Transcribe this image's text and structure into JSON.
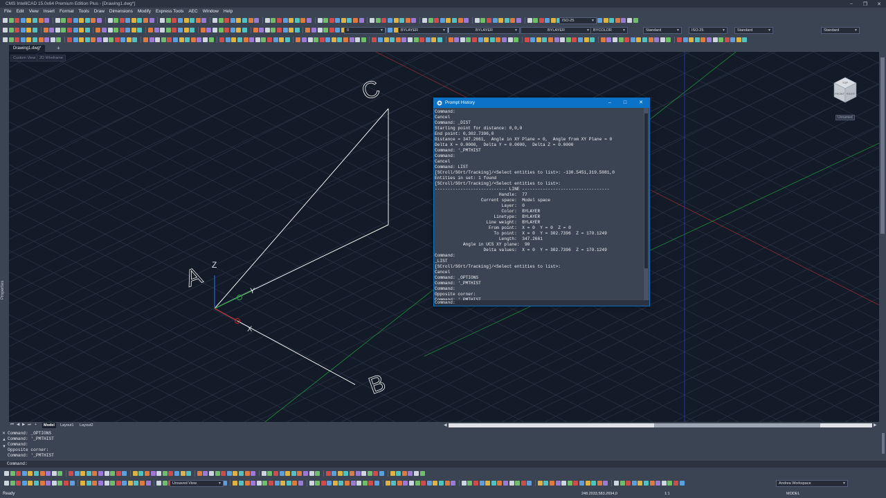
{
  "window": {
    "title": "CMS IntelliCAD 15.0x64 Premium Edition Plus - [Drawing1.dwg*]",
    "minimize": "–",
    "restore": "❐",
    "close": "✕"
  },
  "menu": [
    "File",
    "Edit",
    "View",
    "Insert",
    "Format",
    "Tools",
    "Draw",
    "Dimensions",
    "Modify",
    "Express Tools",
    "AEC",
    "Window",
    "Help"
  ],
  "toolbar": {
    "dimstyle_top": "ISO-25",
    "layer": "0",
    "color": "BYLAYER",
    "linetype": "BYLAYER",
    "lineweight": "BYLAYER",
    "plotstyle": "BYCOLOR",
    "textstyle": "Standard",
    "dimstyle": "ISO-25",
    "tablestyle": "Standard",
    "mleaderstyle": "Standard"
  },
  "tabs": {
    "document": "Drawing1.dwg*",
    "add": "+"
  },
  "viewport": {
    "view_label": "Custom View",
    "style_label": "2D Wireframe",
    "ucs_label": "Unnamed",
    "point_labels": [
      "A",
      "B",
      "C"
    ],
    "axis_labels": {
      "z": "Z",
      "y": "Y",
      "x": "X"
    }
  },
  "viewcube": {
    "top": "TOP",
    "front": "FRONT",
    "right": "RIGHT"
  },
  "left_panel": {
    "label": "Properties"
  },
  "layout_tabs": [
    "Model",
    "Layout1",
    "Layout2"
  ],
  "prompt_history": {
    "title": "Prompt History",
    "lines": [
      "Command:",
      "Cancel",
      "Command: _DIST",
      "Starting point for distance: 0,0,0",
      "End point: 0,302.7396,0",
      "Distance = 347.2661,  Angle in XY Plane = 0,  Angle from XY Plane = 0",
      "Delta X = 0.0000,  Delta Y = 0.0000,  Delta Z = 0.0000",
      "Command: '_PMTHIST",
      "Command:",
      "Cancel",
      "Command: LIST",
      "[SCroll/SOrt/Tracking]/<Select entities to list>: -130.5451,319.5081,0",
      "Entities in set: 1 found",
      "[SCroll/SOrt/Tracking]/<Select entities to list>:",
      "---------------------------- LINE ----------------------------------",
      "                         Handle:  77",
      "                  Current space:  Model space",
      "                          Layer:  0",
      "                          Color:  BYLAYER",
      "                       Linetype:  BYLAYER",
      "                    Line weight:  BYLAYER",
      "                     From point:  X = 0  Y = 0  Z = 0",
      "                       To point:  X = 0  Y = 302.7396  Z = 170.1249",
      "                         Length:  347.2661",
      "           Angle in UCS XY plane:  90",
      "                   Delta values:  X = 0  Y = 302.7396  Z = 170.1249",
      "Command:",
      "_LIST",
      "[SCroll/SOrt/Tracking]/<Select entities to list>:",
      "Cancel",
      "Command: _OPTIONS",
      "Command: '_PMTHIST",
      "Command:",
      "Opposite corner:",
      "Command: '_PMTHIST"
    ],
    "prompt": "Command:"
  },
  "command_history": [
    "Command: _OPTIONS",
    "Command: '_PMTHIST",
    "Command:",
    "Opposite corner:",
    "Command: '_PMTHIST"
  ],
  "command_prompt": "Command:",
  "bottom_toolbar": {
    "named_view": "Unsaved View",
    "workspace": "Andrea Workspace"
  },
  "status": {
    "ready": "Ready",
    "coordinates": "248.2033,583.2694,0",
    "scale": "1:1",
    "mode": "MODEL"
  },
  "colors": {
    "background": "#3b4453",
    "viewport": "#131b29",
    "dialog_title": "#0b73c7",
    "x_axis": "#c0272d",
    "y_axis": "#2ea043",
    "z_axis": "#2b5fd9"
  }
}
